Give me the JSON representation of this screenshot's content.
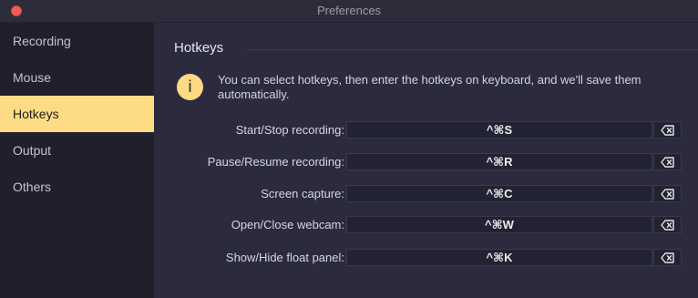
{
  "window": {
    "title": "Preferences"
  },
  "sidebar": {
    "items": [
      {
        "label": "Recording",
        "active": false
      },
      {
        "label": "Mouse",
        "active": false
      },
      {
        "label": "Hotkeys",
        "active": true
      },
      {
        "label": "Output",
        "active": false
      },
      {
        "label": "Others",
        "active": false
      }
    ]
  },
  "main": {
    "section_title": "Hotkeys",
    "info_icon": "info-icon",
    "info_icon_glyph": "i",
    "info_text": "You can select hotkeys, then enter the hotkeys on keyboard, and we'll save them automatically.",
    "hotkeys": [
      {
        "label": "Start/Stop recording:",
        "value": "^⌘S"
      },
      {
        "label": "Pause/Resume recording:",
        "value": "^⌘R"
      },
      {
        "label": "Screen capture:",
        "value": "^⌘C"
      },
      {
        "label": "Open/Close webcam:",
        "value": "^⌘W"
      },
      {
        "label": "Show/Hide float panel:",
        "value": "^⌘K"
      }
    ],
    "clear_icon": "backspace-icon"
  },
  "colors": {
    "accent": "#fddc85",
    "sidebar_bg": "#20202d",
    "content_bg": "#2b2b3d",
    "close_button": "#ec5f5a"
  }
}
